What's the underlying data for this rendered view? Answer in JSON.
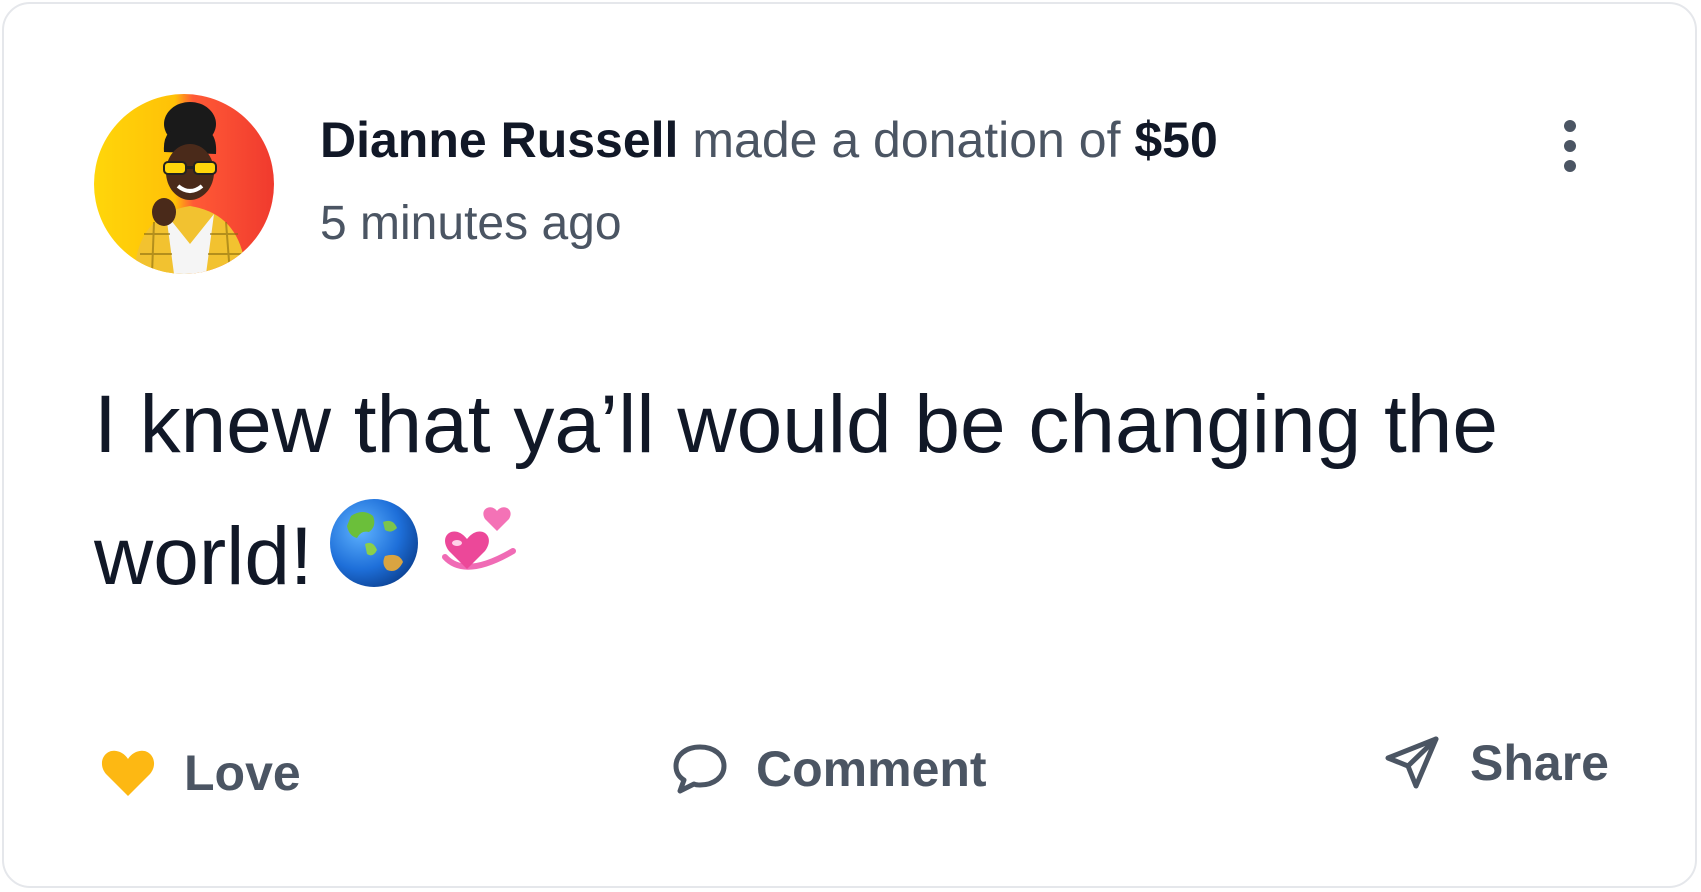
{
  "post": {
    "author_name": "Dianne Russell",
    "action_text": "made a donation of",
    "amount": "$50",
    "timestamp": "5 minutes ago",
    "message": "I knew that ya’ll would be changing the world!"
  },
  "actions": {
    "love_label": "Love",
    "comment_label": "Comment",
    "share_label": "Share"
  },
  "icons": {
    "love": "heart-icon",
    "comment": "speech-bubble-icon",
    "share": "paper-plane-icon",
    "more": "vertical-dots-icon",
    "emoji_1": "globe-asia-australia-emoji",
    "emoji_2": "revolving-hearts-emoji"
  },
  "colors": {
    "love_heart": "#FDB813",
    "muted_text": "#4b5563",
    "primary_text": "#111827",
    "card_border": "#e5e7eb"
  }
}
